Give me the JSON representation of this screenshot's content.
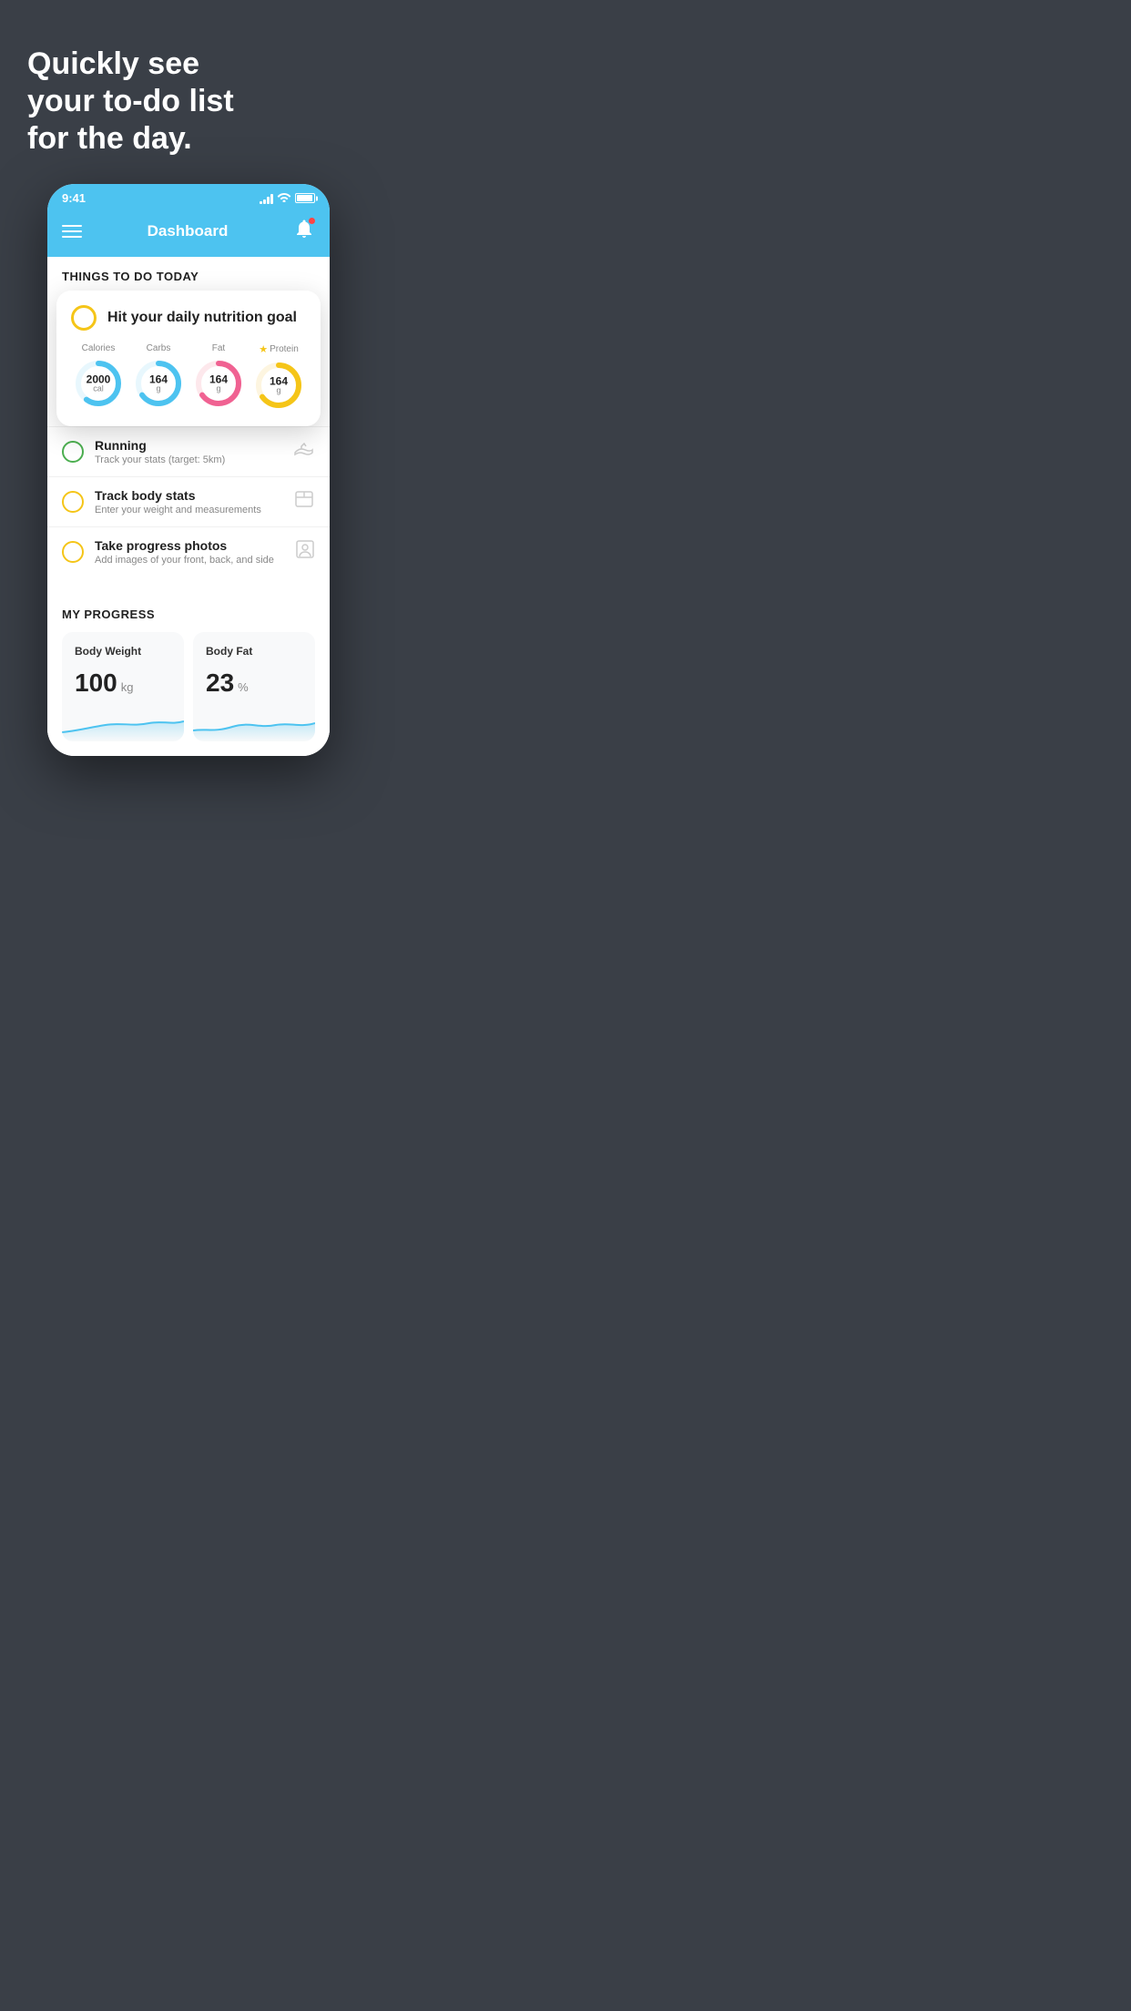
{
  "hero": {
    "title": "Quickly see\nyour to-do list\nfor the day."
  },
  "phone": {
    "status_bar": {
      "time": "9:41"
    },
    "header": {
      "title": "Dashboard"
    },
    "todo_section": {
      "title": "THINGS TO DO TODAY"
    },
    "nutrition_card": {
      "circle_type": "yellow",
      "title": "Hit your daily nutrition goal",
      "items": [
        {
          "label": "Calories",
          "value": "2000",
          "unit": "cal",
          "color": "#4dc3f0",
          "starred": false
        },
        {
          "label": "Carbs",
          "value": "164",
          "unit": "g",
          "color": "#4dc3f0",
          "starred": false
        },
        {
          "label": "Fat",
          "value": "164",
          "unit": "g",
          "color": "#f06292",
          "starred": false
        },
        {
          "label": "Protein",
          "value": "164",
          "unit": "g",
          "color": "#f5c518",
          "starred": true
        }
      ]
    },
    "todo_items": [
      {
        "id": "running",
        "circle": "green",
        "title": "Running",
        "subtitle": "Track your stats (target: 5km)",
        "icon": "shoe"
      },
      {
        "id": "track-body",
        "circle": "yellow",
        "title": "Track body stats",
        "subtitle": "Enter your weight and measurements",
        "icon": "scale"
      },
      {
        "id": "progress-photos",
        "circle": "yellow",
        "title": "Take progress photos",
        "subtitle": "Add images of your front, back, and side",
        "icon": "person"
      }
    ],
    "progress": {
      "title": "MY PROGRESS",
      "cards": [
        {
          "title": "Body Weight",
          "value": "100",
          "unit": "kg"
        },
        {
          "title": "Body Fat",
          "value": "23",
          "unit": "%"
        }
      ]
    }
  }
}
